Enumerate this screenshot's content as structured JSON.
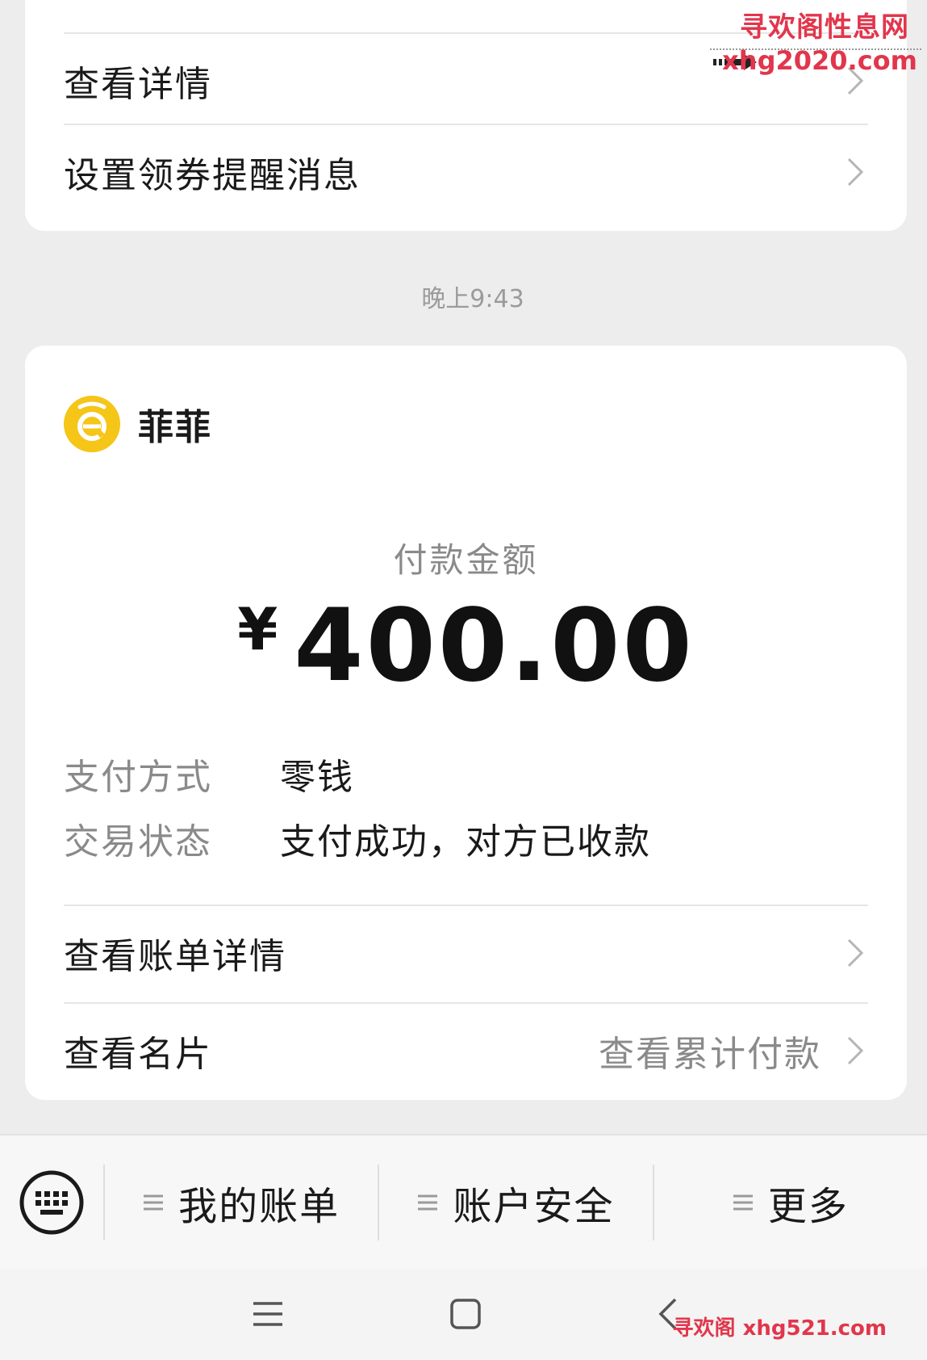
{
  "top_card": {
    "rows": [
      {
        "label": "查看详情"
      },
      {
        "label": "设置领券提醒消息"
      }
    ]
  },
  "timestamp": "晚上9:43",
  "payment_card": {
    "merchant_name": "菲菲",
    "amount_label": "付款金额",
    "currency_symbol": "¥",
    "amount": "400.00",
    "details": [
      {
        "key": "支付方式",
        "value": "零钱"
      },
      {
        "key": "交易状态",
        "value": "支付成功，对方已收款"
      }
    ],
    "actions": [
      {
        "label": "查看账单详情",
        "extra": ""
      },
      {
        "label": "查看名片",
        "extra": "查看累计付款"
      }
    ]
  },
  "menu_bar": {
    "items": [
      {
        "label": "我的账单"
      },
      {
        "label": "账户安全"
      },
      {
        "label": "更多"
      }
    ]
  },
  "watermark": {
    "top_title": "寻欢阁性息网",
    "top_url": "xhg2020.com",
    "bottom": "寻欢阁 xhg521.com"
  },
  "colors": {
    "background": "#ededed",
    "card": "#ffffff",
    "logo_yellow": "#f5c518",
    "watermark_red": "#e1364c"
  }
}
